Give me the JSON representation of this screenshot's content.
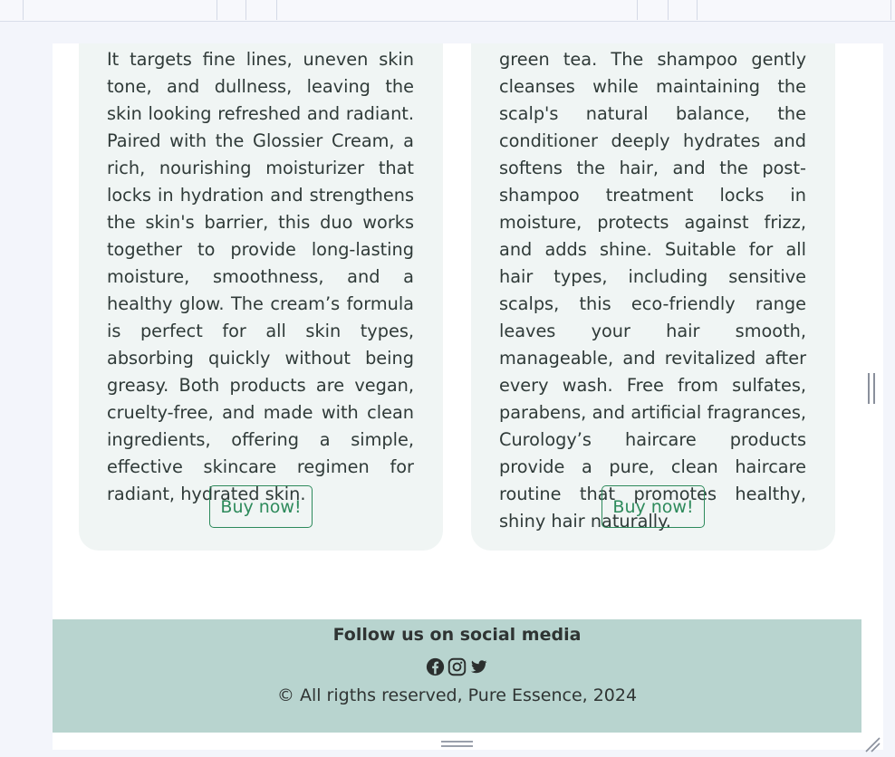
{
  "cards": [
    {
      "description": "It targets fine lines, uneven skin tone, and dullness, leaving the skin looking refreshed and radiant. Paired with the Glossier Cream, a rich, nourishing moisturizer that locks in hydration and strengthens the skin's barrier, this duo works together to provide long-lasting moisture, smoothness, and a healthy glow. The cream’s formula is perfect for all skin types, absorbing quickly without being greasy. Both products are vegan, cruelty-free, and made with clean ingredients, offering a simple, effective skincare regimen for radiant, hydrated skin.",
      "button_label": "Buy now!"
    },
    {
      "description": "green tea. The shampoo gently cleanses while maintaining the scalp's natural balance, the conditioner deeply hydrates and softens the hair, and the post-shampoo treatment locks in moisture, protects against frizz, and adds shine. Suitable for all hair types, including sensitive scalps, this eco-friendly range leaves your hair smooth, manageable, and revitalized after every wash. Free from sulfates, parabens, and artificial fragrances, Curology’s haircare products provide a pure, clean haircare routine that promotes healthy, shiny hair naturally.",
      "button_label": "Buy now!"
    }
  ],
  "footer": {
    "follow_label": "Follow us on social media",
    "social_icons": [
      "facebook-icon",
      "instagram-icon",
      "twitter-icon"
    ],
    "copyright": "© All rigths reserved, Pure Essence, 2024"
  },
  "colors": {
    "card_bg": "#f0f5f4",
    "accent": "#2d8a5b",
    "footer_bg": "#b8d4cf",
    "text": "#2f3a38"
  }
}
